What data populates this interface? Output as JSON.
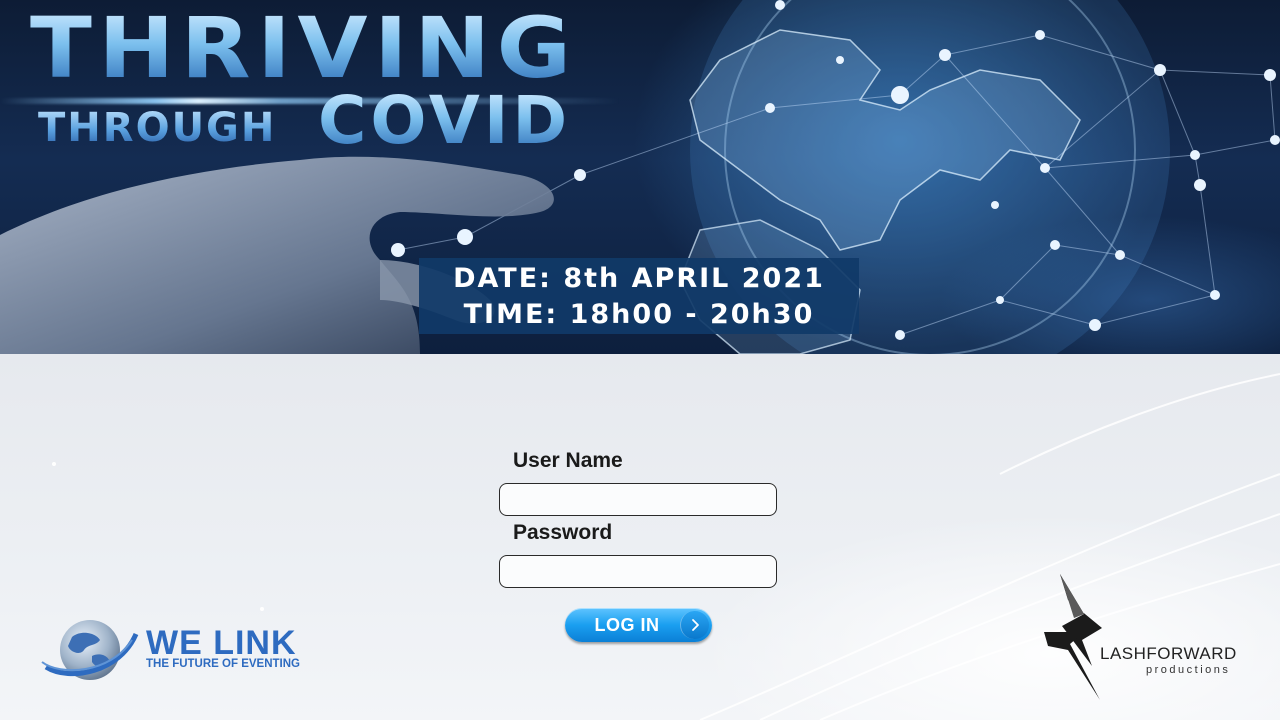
{
  "banner": {
    "title_line1": "THRIVING",
    "title_through": "THROUGH",
    "title_covid": "COVID",
    "date_line": "DATE: 8th APRIL 2021",
    "time_line": "TIME: 18h00 - 20h30"
  },
  "login": {
    "username_label": "User Name",
    "username_value": "",
    "password_label": "Password",
    "password_value": "",
    "submit_label": "LOG IN"
  },
  "logos": {
    "welink_name": "WE LINK",
    "welink_tagline": "THE FUTURE OF EVENTING",
    "flashforward_name": "LASHFORWARD",
    "flashforward_sub": "productions"
  },
  "colors": {
    "banner_bg": "#0d1c35",
    "accent_blue": "#1a9ff0",
    "date_box": "#103a68",
    "brand_blue": "#2e6bc0"
  },
  "icons": [
    "chevron-right-icon",
    "globe-icon",
    "lightning-bolt-icon",
    "hand-image",
    "world-network-image"
  ]
}
